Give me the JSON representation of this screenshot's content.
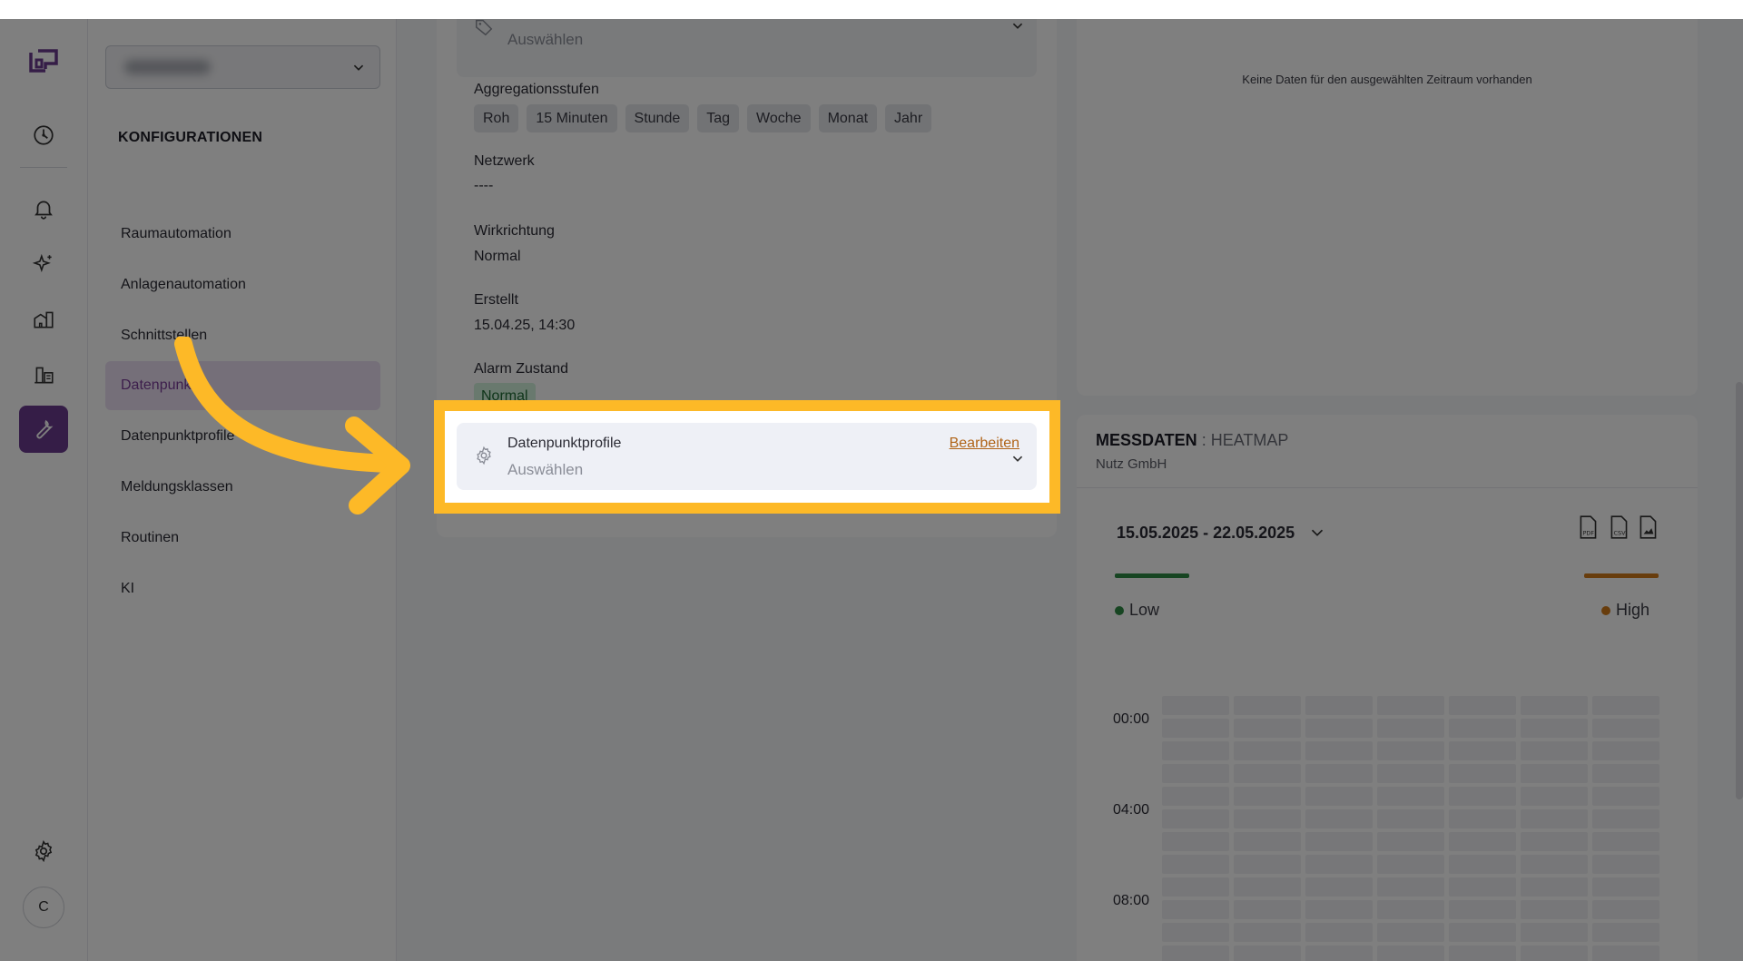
{
  "sidebar_menu": {
    "heading": "KONFIGURATIONEN",
    "items": [
      {
        "label": "Raumautomation"
      },
      {
        "label": "Anlagenautomation"
      },
      {
        "label": "Schnittstellen"
      },
      {
        "label": "Datenpunkte"
      },
      {
        "label": "Datenpunktprofile"
      },
      {
        "label": "Meldungsklassen"
      },
      {
        "label": "Routinen"
      },
      {
        "label": "KI"
      }
    ],
    "active_item": "Datenpunkte"
  },
  "user": {
    "initial": "C"
  },
  "rail_icons": [
    "logo-icon",
    "dashboard-gauge-icon",
    "bell-icon",
    "sparkles-icon",
    "buildings-icon",
    "building-list-icon",
    "wrench-icon",
    "settings-gear-icon"
  ],
  "detail": {
    "top_select_placeholder": "Auswählen",
    "aggregation_label": "Aggregationsstufen",
    "aggregation_levels": [
      "Roh",
      "15 Minuten",
      "Stunde",
      "Tag",
      "Woche",
      "Monat",
      "Jahr"
    ],
    "network_label": "Netzwerk",
    "network_value": "----",
    "direction_label": "Wirkrichtung",
    "direction_value": "Normal",
    "created_label": "Erstellt",
    "created_value": "15.04.25, 14:30",
    "alarm_label": "Alarm Zustand",
    "alarm_value": "Normal",
    "profile_field": {
      "label": "Datenpunktprofile",
      "placeholder": "Auswählen",
      "edit_label": "Bearbeiten"
    }
  },
  "chart_top": {
    "empty_message": "Keine Daten für den ausgewählten Zeitraum vorhanden"
  },
  "measurement": {
    "title_bold": "MESSDATEN",
    "title_rest": " : HEATMAP",
    "subtitle": "Nutz GmbH",
    "date_range": "15.05.2025 - 22.05.2025",
    "downloads": [
      "pdf-file-icon",
      "csv-file-icon",
      "image-file-icon"
    ],
    "legend_low": "Low",
    "legend_high": "High",
    "legend_low_color": "#2f8a45",
    "legend_high_color": "#d07a1b",
    "hour_labels": [
      "00:00",
      "04:00",
      "08:00"
    ]
  },
  "colors": {
    "accent": "#6b3b8f",
    "highlight": "#fdb927",
    "edit_link": "#b06418"
  }
}
